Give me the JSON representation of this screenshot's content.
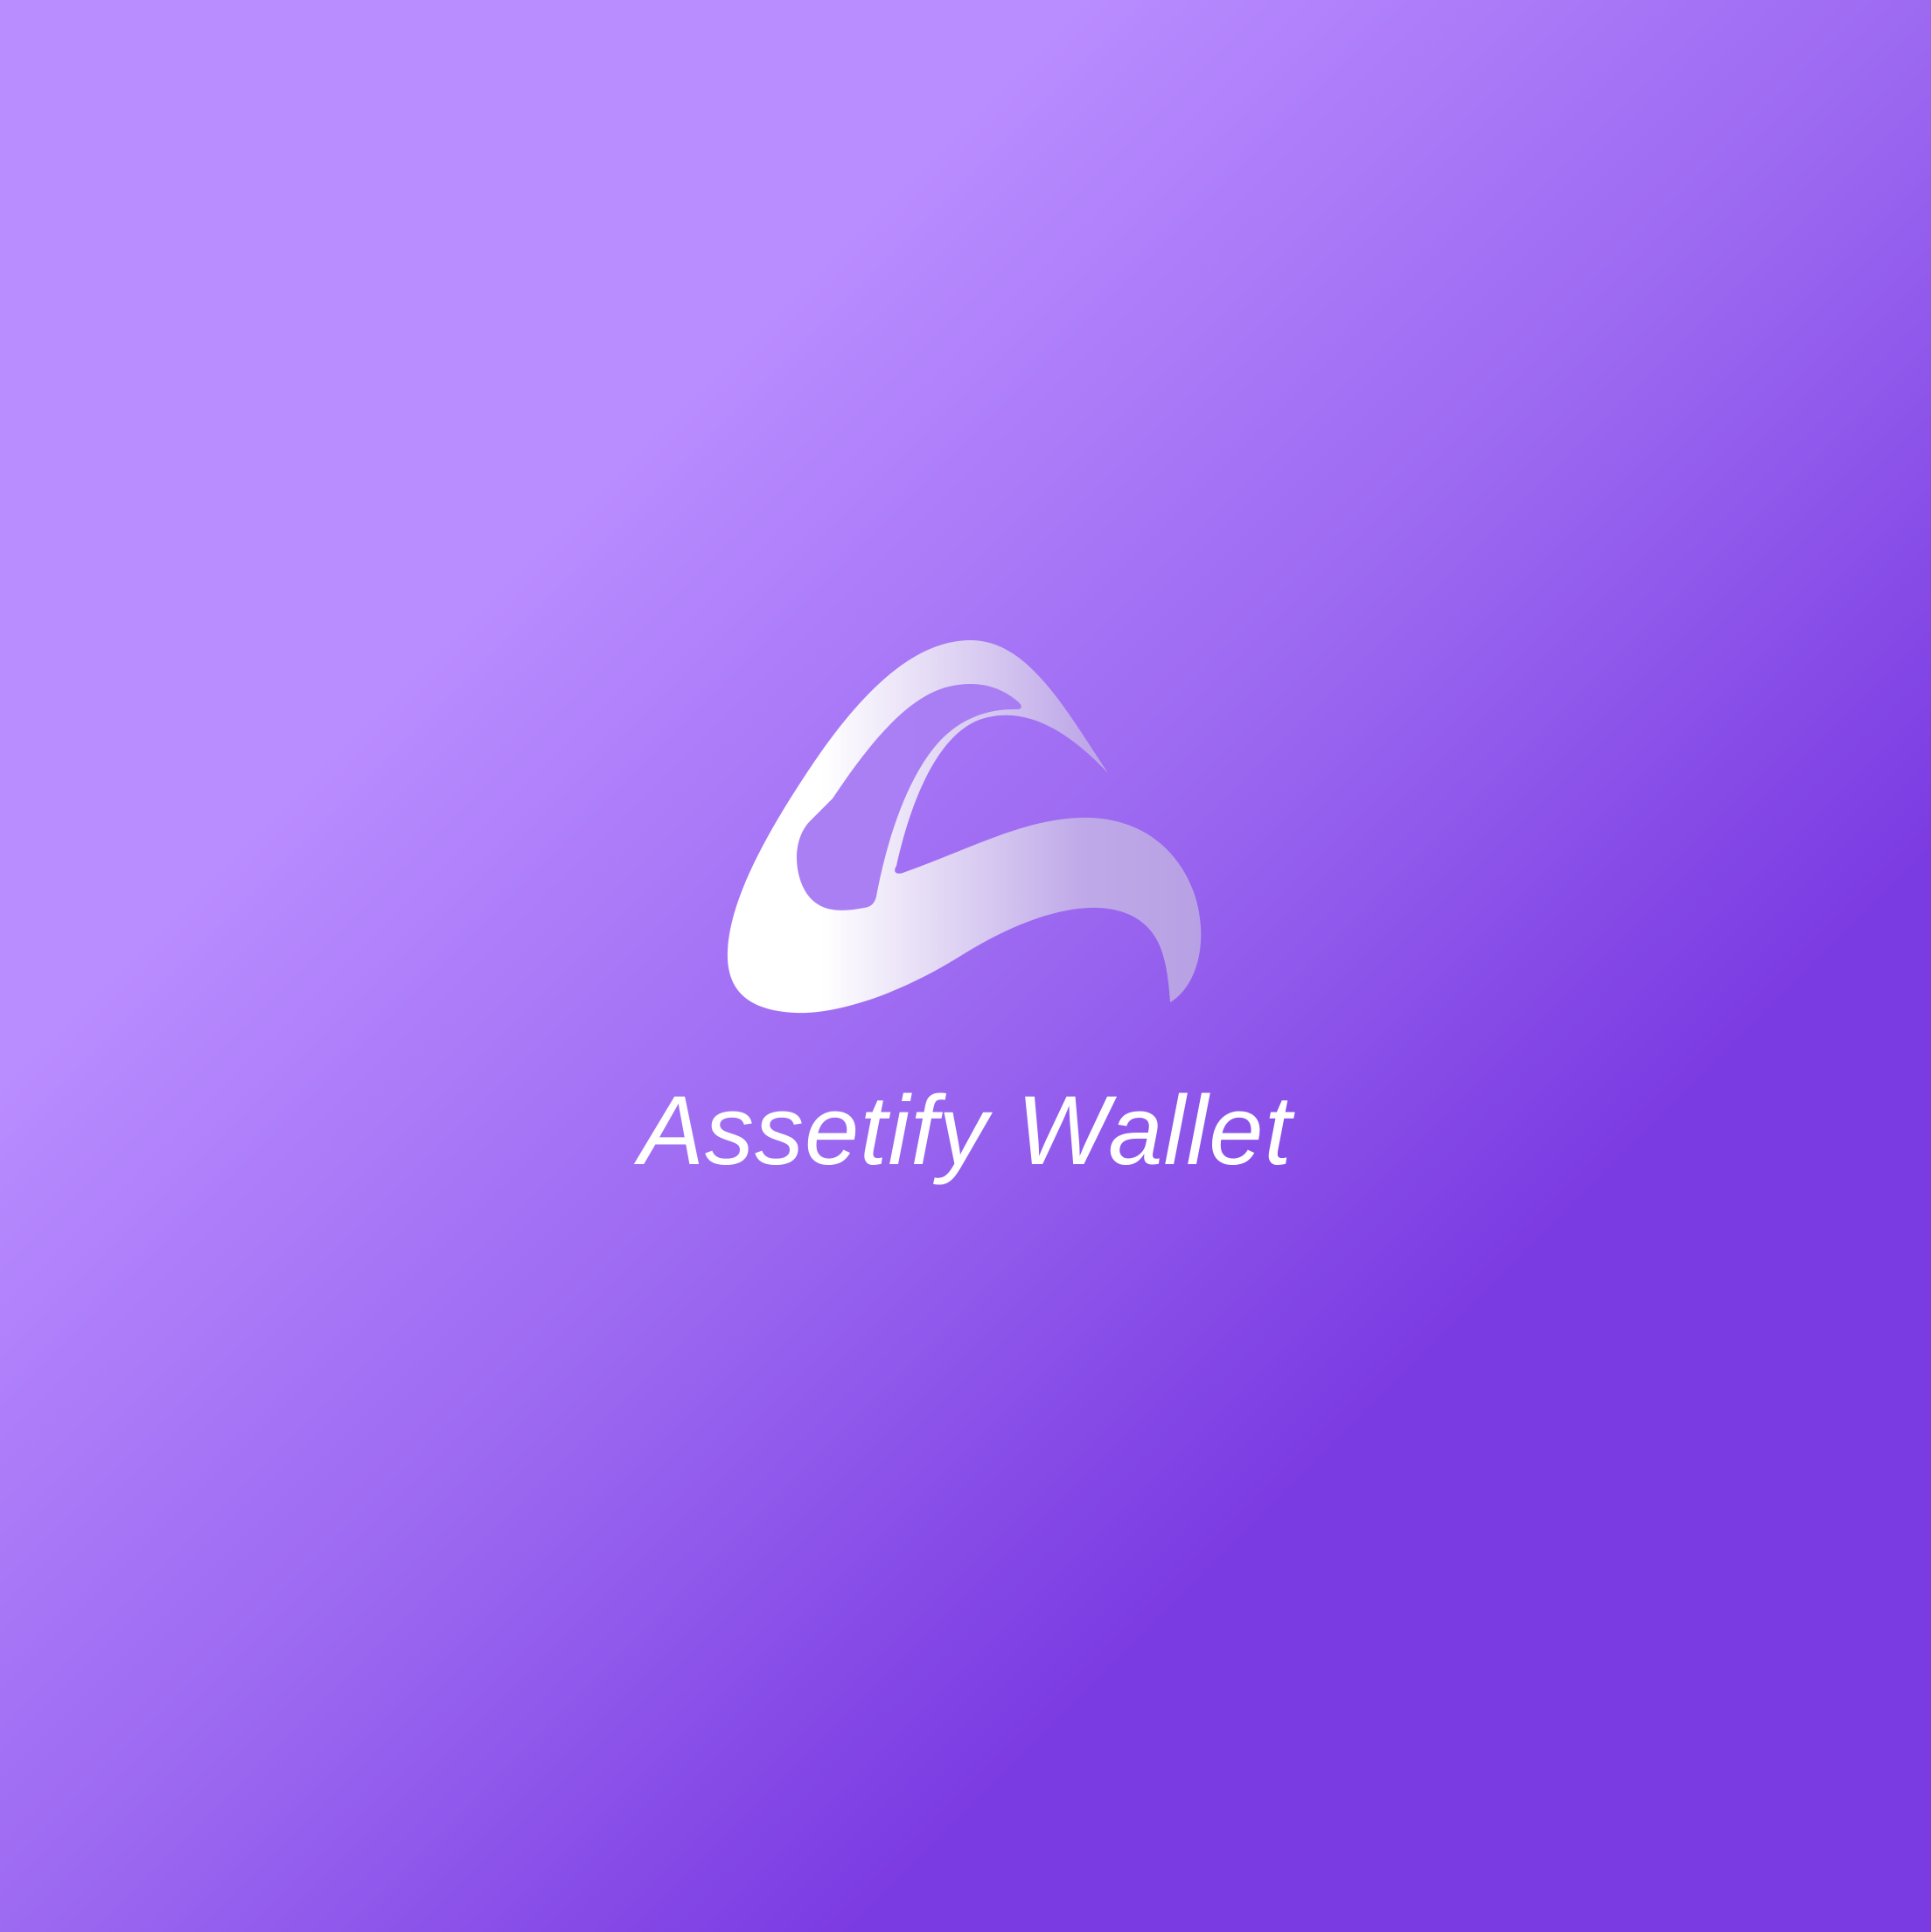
{
  "splash": {
    "app_name": "Assetify Wallet",
    "logo_icon": "assetify-swoosh-logo-icon",
    "colors": {
      "background_light": "#b98cff",
      "background_dark": "#7b3be2",
      "logo_light": "#ffffff",
      "logo_dark": "#b9a3e6",
      "text": "#ffffff"
    }
  }
}
